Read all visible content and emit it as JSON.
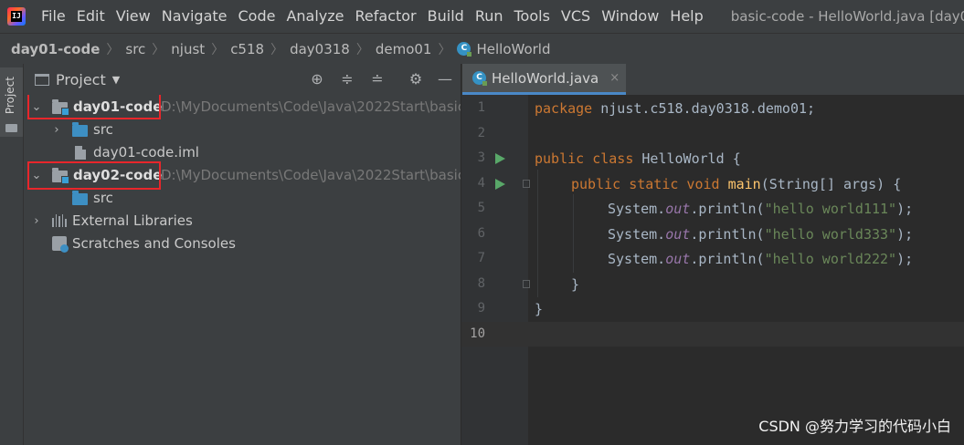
{
  "menubar": {
    "logo_text": "IJ",
    "items": [
      "File",
      "Edit",
      "View",
      "Navigate",
      "Code",
      "Analyze",
      "Refactor",
      "Build",
      "Run",
      "Tools",
      "VCS",
      "Window",
      "Help"
    ],
    "window_title": "basic-code - HelloWorld.java [day0"
  },
  "breadcrumb": {
    "items": [
      "day01-code",
      "src",
      "njust",
      "c518",
      "day0318",
      "demo01",
      "HelloWorld"
    ],
    "class_icon_letter": "C"
  },
  "left_strip": {
    "tab_label": "Project"
  },
  "project_panel": {
    "title": "Project",
    "toolbar_icons": [
      "locate-icon",
      "expand-all-icon",
      "collapse-all-icon",
      "gear-icon",
      "minimize-icon"
    ],
    "tree": [
      {
        "label": "day01-code",
        "path": "D:\\MyDocuments\\Code\\Java\\2022Start\\basic",
        "type": "module",
        "expanded": true,
        "highlighted": true
      },
      {
        "label": "src",
        "type": "source-folder",
        "expanded": false
      },
      {
        "label": "day01-code.iml",
        "type": "iml-file"
      },
      {
        "label": "day02-code",
        "path": "D:\\MyDocuments\\Code\\Java\\2022Start\\basic",
        "type": "module",
        "expanded": true,
        "highlighted": true
      },
      {
        "label": "src",
        "type": "source-folder"
      },
      {
        "label": "External Libraries",
        "type": "libraries",
        "expanded": false
      },
      {
        "label": "Scratches and Consoles",
        "type": "scratches"
      }
    ]
  },
  "editor": {
    "tab_label": "HelloWorld.java",
    "tab_close": "×",
    "line_numbers": [
      "1",
      "2",
      "3",
      "4",
      "5",
      "6",
      "7",
      "8",
      "9",
      "10"
    ],
    "current_line": "10",
    "code": {
      "line1": {
        "kw": "package",
        "rest": " njust.c518.day0318.demo01;"
      },
      "line3": {
        "kw": "public class",
        "rest": " HelloWorld {"
      },
      "line4": {
        "kw": "public static void",
        "method": "main",
        "rest": "(String[] args) {"
      },
      "line5": {
        "pre": "System.",
        "field": "out",
        "mid": ".println(",
        "str": "\"hello world111\"",
        "post": ");"
      },
      "line6": {
        "pre": "System.",
        "field": "out",
        "mid": ".println(",
        "str": "\"hello world333\"",
        "post": ");"
      },
      "line7": {
        "pre": "System.",
        "field": "out",
        "mid": ".println(",
        "str": "\"hello world222\"",
        "post": ");"
      },
      "line8": "}",
      "line9": "}"
    }
  },
  "watermark": "CSDN @努力学习的代码小白",
  "colors": {
    "keyword": "#cc7832",
    "method": "#ffc66d",
    "string": "#6a8759",
    "static_field": "#9876aa",
    "highlight_box": "#e8262b",
    "run_icon": "#59a869"
  }
}
